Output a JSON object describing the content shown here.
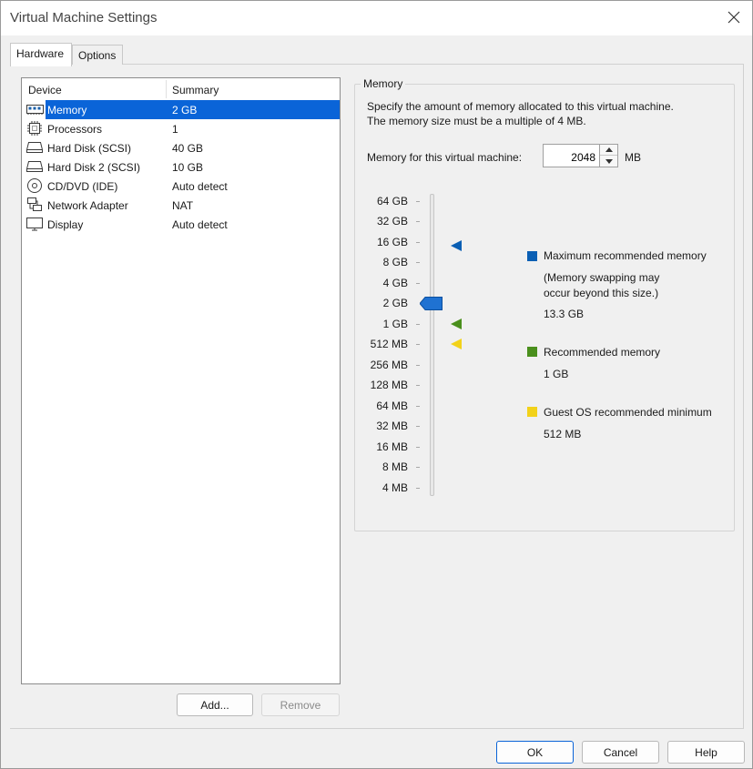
{
  "window": {
    "title": "Virtual Machine Settings"
  },
  "tabs": [
    {
      "label": "Hardware",
      "active": true
    },
    {
      "label": "Options",
      "active": false
    }
  ],
  "device_list": {
    "header_device": "Device",
    "header_summary": "Summary",
    "items": [
      {
        "name": "Memory",
        "summary": "2 GB",
        "icon": "memory-icon",
        "selected": true
      },
      {
        "name": "Processors",
        "summary": "1",
        "icon": "processor-icon"
      },
      {
        "name": "Hard Disk (SCSI)",
        "summary": "40 GB",
        "icon": "hard-disk-icon"
      },
      {
        "name": "Hard Disk 2 (SCSI)",
        "summary": "10 GB",
        "icon": "hard-disk-icon"
      },
      {
        "name": "CD/DVD (IDE)",
        "summary": "Auto detect",
        "icon": "cd-dvd-icon"
      },
      {
        "name": "Network Adapter",
        "summary": "NAT",
        "icon": "network-adapter-icon"
      },
      {
        "name": "Display",
        "summary": "Auto detect",
        "icon": "display-icon"
      }
    ],
    "add_label": "Add...",
    "remove_label": "Remove"
  },
  "memory": {
    "group_title": "Memory",
    "description_line1": "Specify the amount of memory allocated to this virtual machine.",
    "description_line2": "The memory size must be a multiple of 4 MB.",
    "field_label": "Memory for this virtual machine:",
    "value": "2048",
    "unit": "MB",
    "scale_labels": [
      "64 GB",
      "32 GB",
      "16 GB",
      "8 GB",
      "4 GB",
      "2 GB",
      "1 GB",
      "512 MB",
      "256 MB",
      "128 MB",
      "64 MB",
      "32 MB",
      "16 MB",
      "8 MB",
      "4 MB"
    ],
    "slider_value": "2 GB",
    "legend": {
      "max": {
        "label": "Maximum recommended memory",
        "note_line1": "(Memory swapping may",
        "note_line2": "occur beyond this size.)",
        "value": "13.3 GB",
        "color": "#0a5fb4"
      },
      "recommended": {
        "label": "Recommended memory",
        "value": "1 GB",
        "color": "#4a8f1c"
      },
      "guest_min": {
        "label": "Guest OS recommended minimum",
        "value": "512 MB",
        "color": "#f2d21a"
      }
    }
  },
  "footer": {
    "ok_label": "OK",
    "cancel_label": "Cancel",
    "help_label": "Help"
  }
}
